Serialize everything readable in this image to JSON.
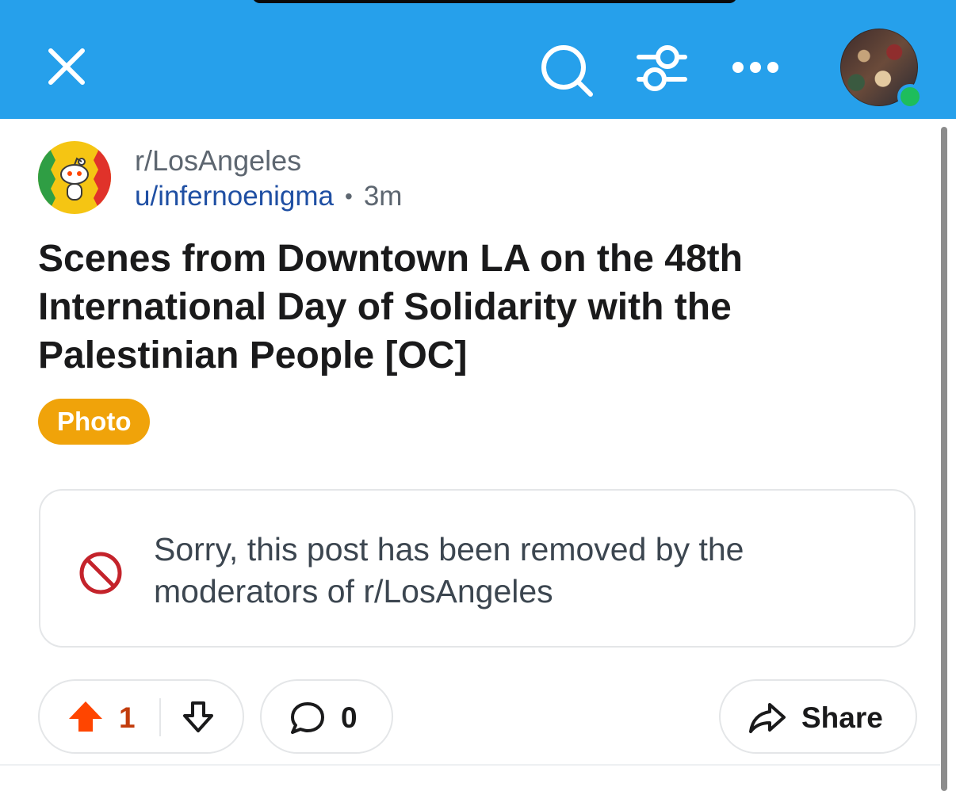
{
  "top_bar": {
    "close_icon": "close-icon",
    "search_icon": "search-icon",
    "filter_icon": "sliders-icon",
    "more_icon": "more-horizontal-icon",
    "avatar_status": "online"
  },
  "post": {
    "subreddit": "r/LosAngeles",
    "author": "u/infernoenigma",
    "separator": "•",
    "age": "3m",
    "title": "Scenes from Downtown LA on the 48th International Day of Solidarity with the Palestinian People [OC]",
    "flair": "Photo",
    "removed_notice": "Sorry, this post has been removed by the moderators of r/LosAngeles"
  },
  "actions": {
    "vote_count": "1",
    "comment_count": "0",
    "share_label": "Share"
  },
  "colors": {
    "header": "#26a0eb",
    "flair": "#f0a30a",
    "upvote": "#ff4500",
    "link": "#1f4fa3",
    "removed_icon": "#c4232b"
  }
}
